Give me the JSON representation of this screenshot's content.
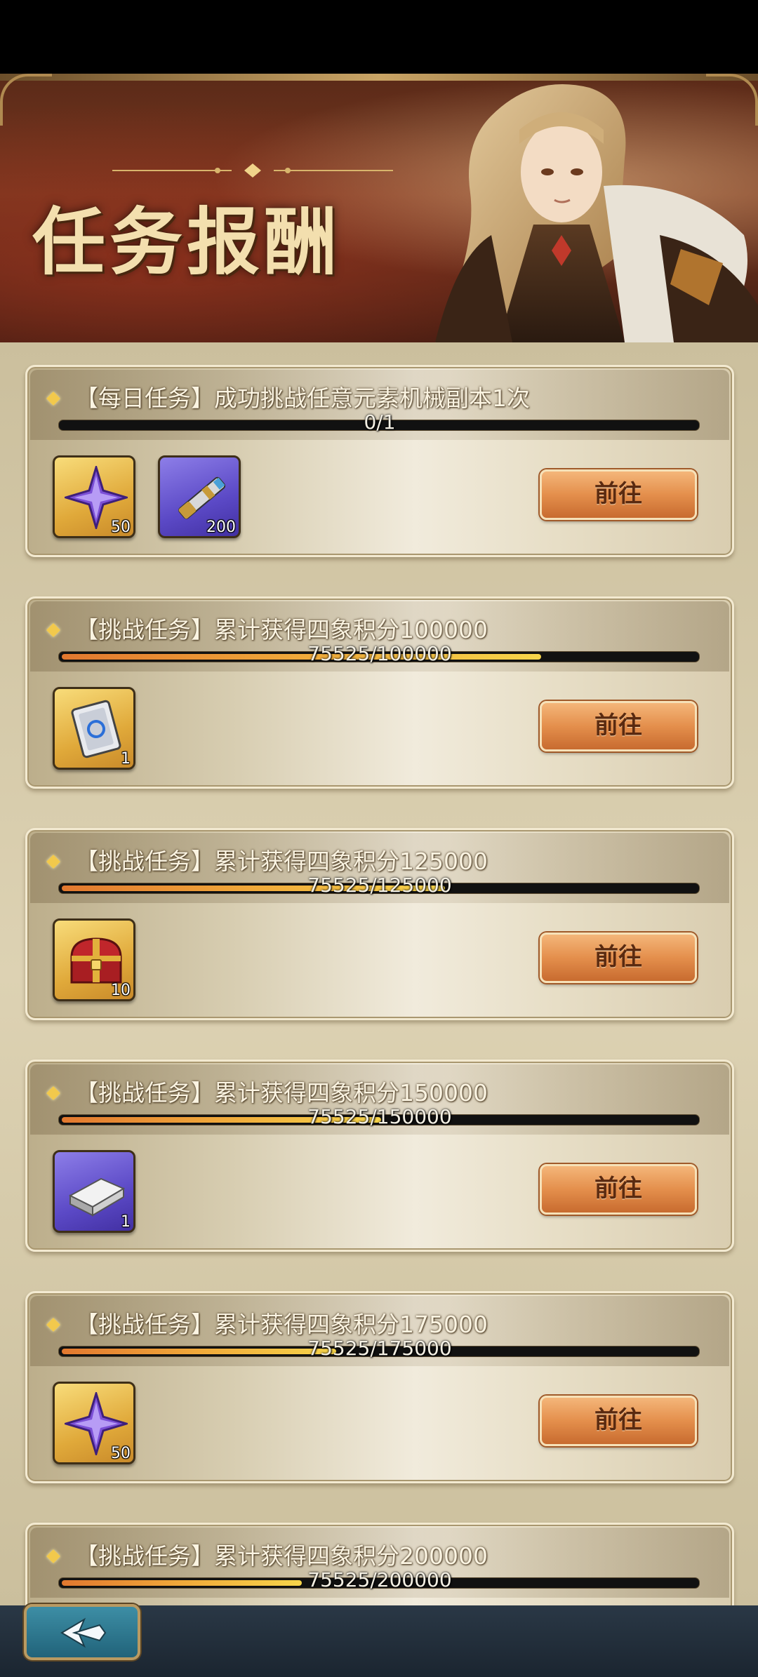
{
  "banner": {
    "title": "任务报酬"
  },
  "tasks": [
    {
      "title": "【每日任务】成功挑战任意元素机械副本1次",
      "progress_text": "0/1",
      "progress_fraction": 0,
      "button_label": "前往",
      "rewards": [
        {
          "icon": "purple-star-crystal-icon",
          "count": "50",
          "frame": "gold"
        },
        {
          "icon": "telescope-icon",
          "count": "200",
          "frame": "purple"
        }
      ]
    },
    {
      "title": "【挑战任务】累计获得四象积分100000",
      "progress_text": "75525/100000",
      "progress_fraction": 0.755,
      "button_label": "前往",
      "rewards": [
        {
          "icon": "card-ticket-icon",
          "count": "1",
          "frame": "gold"
        }
      ]
    },
    {
      "title": "【挑战任务】累计获得四象积分125000",
      "progress_text": "75525/125000",
      "progress_fraction": 0.604,
      "button_label": "前往",
      "rewards": [
        {
          "icon": "treasure-chest-icon",
          "count": "10",
          "frame": "gold"
        }
      ]
    },
    {
      "title": "【挑战任务】累计获得四象积分150000",
      "progress_text": "75525/150000",
      "progress_fraction": 0.503,
      "button_label": "前往",
      "rewards": [
        {
          "icon": "silver-ingot-icon",
          "count": "1",
          "frame": "purple"
        }
      ]
    },
    {
      "title": "【挑战任务】累计获得四象积分175000",
      "progress_text": "75525/175000",
      "progress_fraction": 0.432,
      "button_label": "前往",
      "rewards": [
        {
          "icon": "purple-star-crystal-icon",
          "count": "50",
          "frame": "gold"
        }
      ]
    },
    {
      "title": "【挑战任务】累计获得四象积分200000",
      "progress_text": "75525/200000",
      "progress_fraction": 0.378,
      "button_label": "前往",
      "rewards": []
    }
  ],
  "colors": {
    "accent": "#e48f4c",
    "progress_fill": "#f0a93a",
    "panel": "#ddd2b3"
  }
}
